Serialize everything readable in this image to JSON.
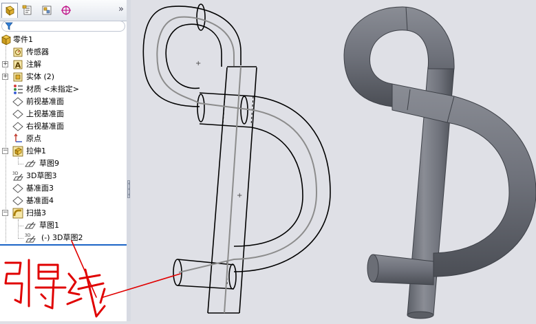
{
  "panel": {
    "more_glyph": "»",
    "tabs": [
      {
        "icon": "feature-manager-icon",
        "active": true
      },
      {
        "icon": "property-manager-icon",
        "active": false
      },
      {
        "icon": "configuration-manager-icon",
        "active": false
      },
      {
        "icon": "dimxpert-manager-icon",
        "active": false
      }
    ],
    "filter_icon": "filter-icon"
  },
  "tree": {
    "items": [
      {
        "label": "零件1",
        "icon": "part-icon"
      },
      {
        "label": "传感器",
        "icon": "sensor-icon"
      },
      {
        "label": "注解",
        "icon": "annotations-icon",
        "expander": "+"
      },
      {
        "label": "实体 (2)",
        "icon": "solid-bodies-icon",
        "expander": "+"
      },
      {
        "label": "材质 <未指定>",
        "icon": "material-icon"
      },
      {
        "label": "前视基准面",
        "icon": "plane-icon"
      },
      {
        "label": "上视基准面",
        "icon": "plane-icon"
      },
      {
        "label": "右视基准面",
        "icon": "plane-icon"
      },
      {
        "label": "原点",
        "icon": "origin-icon"
      },
      {
        "label": "拉伸1",
        "icon": "extrude-icon",
        "expander": "−"
      },
      {
        "label": "草图9",
        "icon": "sketch-icon"
      },
      {
        "label": "3D草图3",
        "icon": "sketch-3d-icon"
      },
      {
        "label": "基准面3",
        "icon": "plane-icon"
      },
      {
        "label": "基准面4",
        "icon": "plane-icon"
      },
      {
        "label": "扫描3",
        "icon": "sweep-icon",
        "expander": "−"
      },
      {
        "label": "草图1",
        "icon": "sketch-icon"
      },
      {
        "label": "(-) 3D草图2",
        "icon": "sketch-3d-icon"
      }
    ]
  },
  "splitter": {
    "glyph": "‹ ‹ ‹"
  },
  "viewport": {
    "wireframe_color": "#000000",
    "path_color": "#8c8c8c",
    "shaded_color": "#73767e"
  },
  "annotation": {
    "handwritten_text": "引导线",
    "ink_color": "#e00000"
  },
  "colors": {
    "rollback_bar": "#1a63c6",
    "tab_highlight": "#d4a017"
  }
}
